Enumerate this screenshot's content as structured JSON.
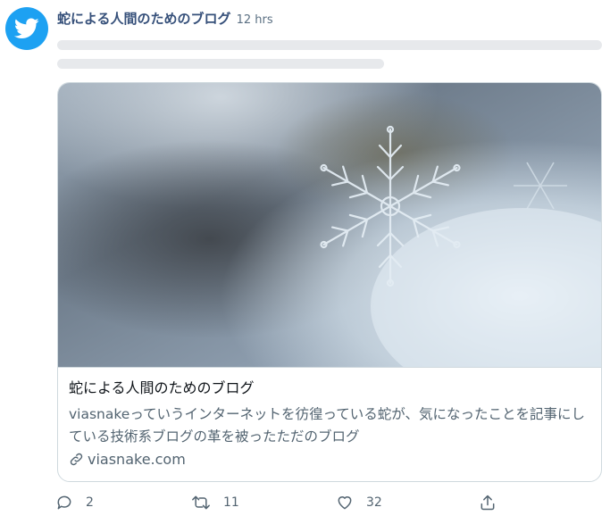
{
  "tweet": {
    "account_name": "蛇による人間のためのブログ",
    "time": "12 hrs",
    "avatar_icon": "twitter-bird-icon",
    "brand_color": "#1da1f2"
  },
  "card": {
    "image": "snowflake-photo",
    "title": "蛇による人間のためのブログ",
    "description": "viasnakeっていうインターネットを彷徨っている蛇が、気になったことを記事にしている技術系ブログの革を被ったただのブログ",
    "link_icon": "link-icon",
    "domain": "viasnake.com"
  },
  "actions": {
    "reply_icon": "reply-icon",
    "reply_count": "2",
    "retweet_icon": "retweet-icon",
    "retweet_count": "11",
    "like_icon": "heart-icon",
    "like_count": "32",
    "share_icon": "share-icon"
  }
}
